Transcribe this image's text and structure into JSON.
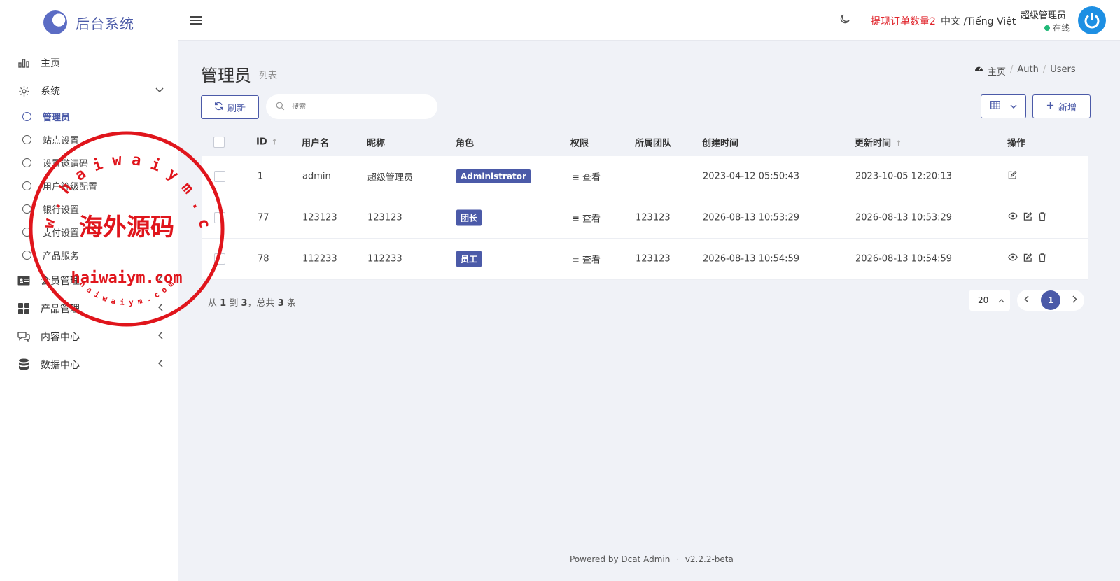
{
  "brand": {
    "title": "后台系统"
  },
  "sidebar": {
    "items": [
      {
        "label": "主页",
        "icon": "bar-chart-icon"
      },
      {
        "label": "系统",
        "icon": "gear-icon",
        "caret": "⌄"
      },
      {
        "label": "会员管理",
        "icon": "id-card-icon",
        "caret": "‹"
      },
      {
        "label": "产品管理",
        "icon": "grid-icon",
        "caret": "‹"
      },
      {
        "label": "内容中心",
        "icon": "chat-icon",
        "caret": "‹"
      },
      {
        "label": "数据中心",
        "icon": "database-icon",
        "caret": "‹"
      }
    ],
    "sub_items": [
      "管理员",
      "站点设置",
      "设置邀请码",
      "用户等级配置",
      "银行设置",
      "支付设置",
      "产品服务"
    ]
  },
  "header": {
    "withdraw_label": "提现订单数量2",
    "lang_label": "中文 /Tiếng Việt",
    "user_name": "超级管理员",
    "user_status": "在线"
  },
  "page": {
    "title": "管理员",
    "subtitle": "列表",
    "breadcrumb": [
      "主页",
      "Auth",
      "Users"
    ]
  },
  "toolbar": {
    "refresh_label": "刷新",
    "search_placeholder": "搜索",
    "new_label": "新增"
  },
  "table": {
    "headers": [
      "ID",
      "用户名",
      "昵称",
      "角色",
      "权限",
      "所属团队",
      "创建时间",
      "更新时间",
      "操作"
    ],
    "rows": [
      {
        "id": "1",
        "username": "admin",
        "nickname": "超级管理员",
        "role": "Administrator",
        "perm": "查看",
        "team": "",
        "created": "2023-04-12 05:50:43",
        "updated": "2023-10-05 12:20:13"
      },
      {
        "id": "77",
        "username": "123123",
        "nickname": "123123",
        "role": "团长",
        "perm": "查看",
        "team": "123123",
        "created": "2026-08-13 10:53:29",
        "updated": "2026-08-13 10:53:29"
      },
      {
        "id": "78",
        "username": "112233",
        "nickname": "112233",
        "role": "员工",
        "perm": "查看",
        "team": "123123",
        "created": "2026-08-13 10:54:59",
        "updated": "2026-08-13 10:54:59"
      }
    ]
  },
  "pagination": {
    "summary_from": "从",
    "summary_start": "1",
    "summary_to": "到",
    "summary_end": "3",
    "summary_total_label": "，总共",
    "summary_total": "3",
    "summary_unit": "条",
    "per_page": "20",
    "current_page": "1"
  },
  "footer": {
    "powered": "Powered by Dcat Admin",
    "version": "v2.2.2-beta"
  },
  "watermark": {
    "top_arc": "w w w . h a i w a i y m . c o m",
    "center": "海外源码",
    "bottom": "haiwaiym.com",
    "bottom_arc": "h a i w a i y m . c o m"
  },
  "colors": {
    "accent": "#4b5aa8",
    "alert": "#e0242b",
    "online": "#21b978",
    "stamp": "#e0151c"
  }
}
